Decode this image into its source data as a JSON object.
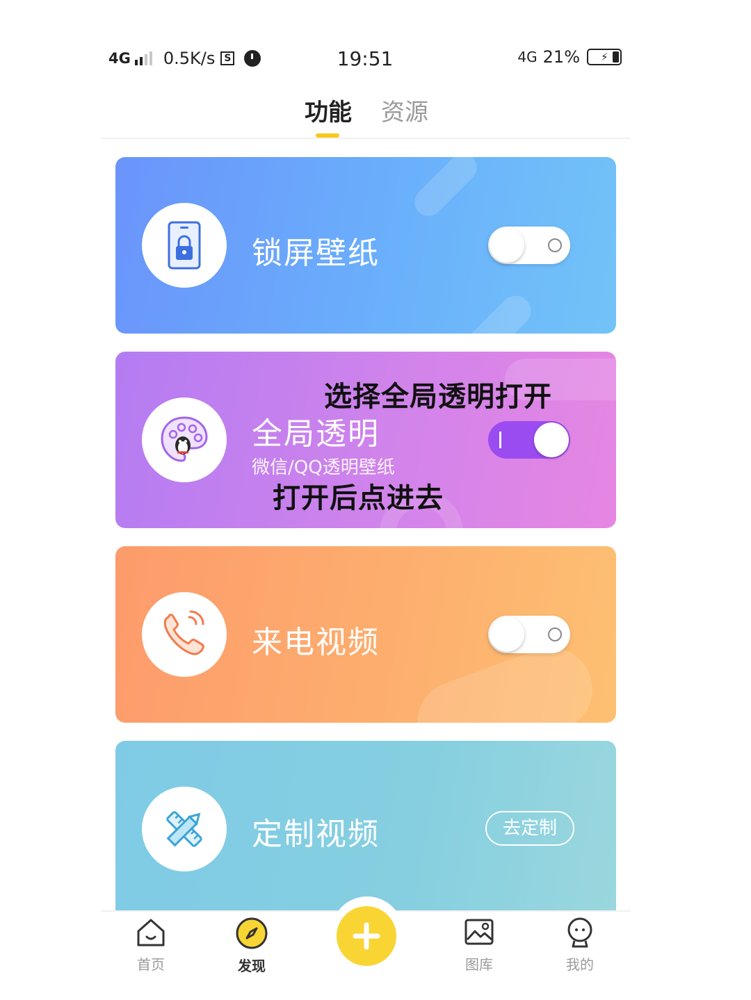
{
  "status_bar": {
    "network_left": "4G",
    "speed": "0.5K/s",
    "s_badge": "S",
    "time": "19:51",
    "network_right": "4G",
    "battery": "21%",
    "icons": [
      "signal-icon",
      "alarm-icon",
      "battery-charging-icon"
    ]
  },
  "tabs": [
    {
      "label": "功能",
      "active": true
    },
    {
      "label": "资源",
      "active": false
    }
  ],
  "cards": {
    "lock": {
      "title": "锁屏壁纸",
      "toggle_on": false,
      "icon": "lock-phone-icon"
    },
    "global": {
      "title": "全局透明",
      "subtitle": "微信/QQ透明壁纸",
      "toggle_on": true,
      "icon": "palette-icon"
    },
    "call": {
      "title": "来电视频",
      "toggle_on": false,
      "icon": "phone-call-icon"
    },
    "custom": {
      "title": "定制视频",
      "button": "去定制",
      "icon": "pencil-ruler-icon"
    }
  },
  "overlay": {
    "top": "选择全局透明打开",
    "bottom": "打开后点进去"
  },
  "bottom_nav": [
    {
      "label": "首页",
      "icon": "home-icon",
      "active": false
    },
    {
      "label": "发现",
      "icon": "compass-icon",
      "active": true
    },
    {
      "label": "",
      "icon": "plus-icon",
      "active": false
    },
    {
      "label": "图库",
      "icon": "gallery-icon",
      "active": false
    },
    {
      "label": "我的",
      "icon": "profile-icon",
      "active": false
    }
  ],
  "colors": {
    "accent": "#f8c81c",
    "fab": "#f9d534",
    "lock_card": "#6aa8fb",
    "global_card": "#c97fee",
    "call_card": "#fdab6e",
    "custom_card": "#84cde2",
    "toggle_on": "#9a4cf0"
  }
}
